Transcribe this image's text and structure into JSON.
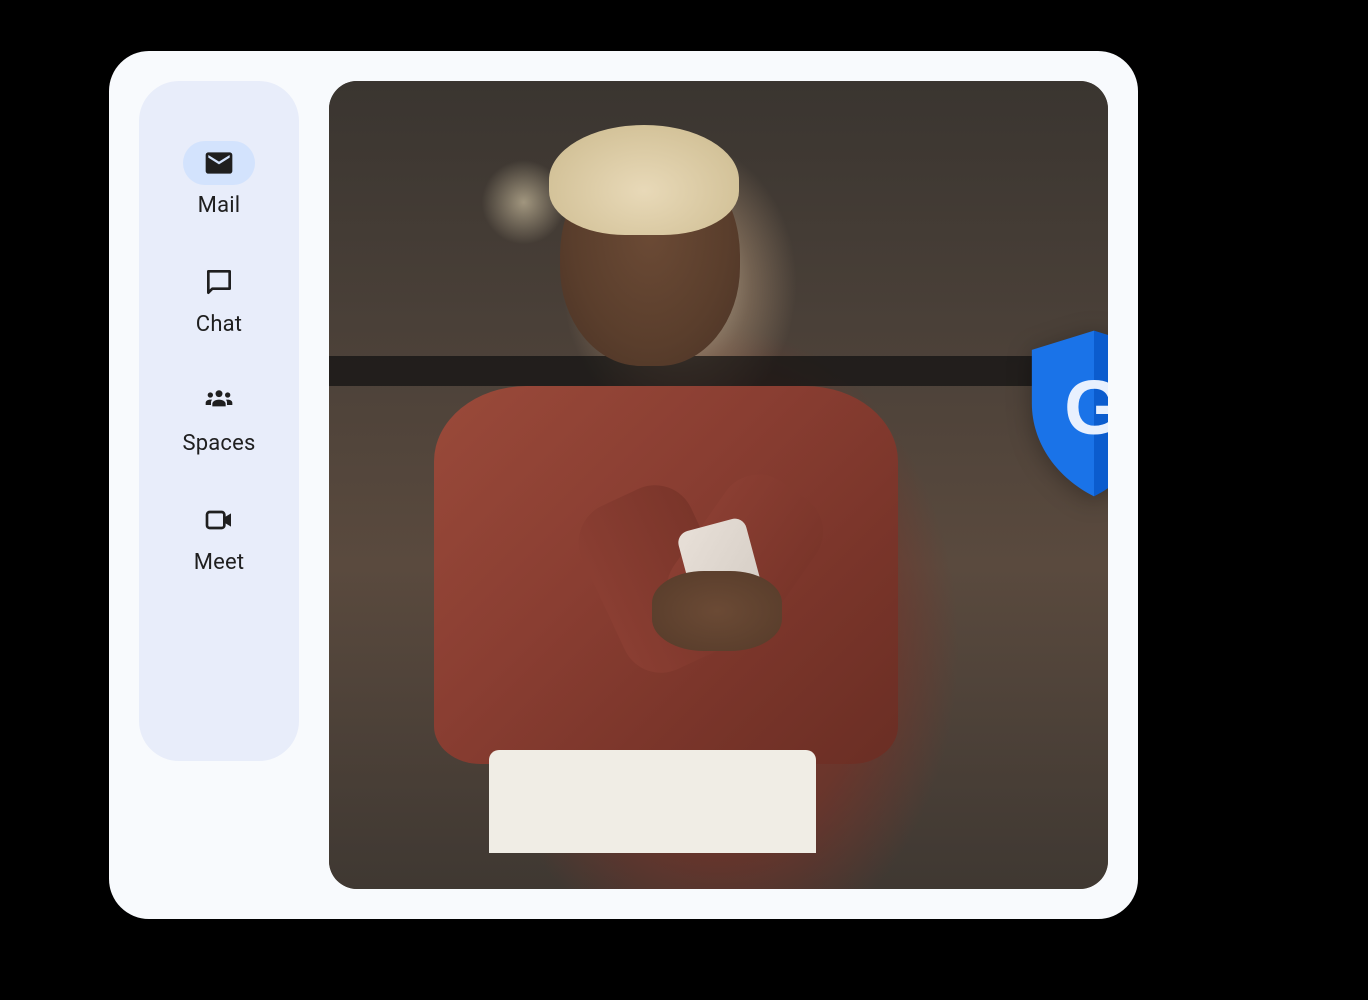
{
  "sidebar": {
    "items": [
      {
        "label": "Mail",
        "icon": "mail-icon",
        "active": true
      },
      {
        "label": "Chat",
        "icon": "chat-icon",
        "active": false
      },
      {
        "label": "Spaces",
        "icon": "spaces-icon",
        "active": false
      },
      {
        "label": "Meet",
        "icon": "meet-icon",
        "active": false
      }
    ]
  },
  "badge": {
    "letter": "G",
    "shield_color_left": "#1a73e8",
    "shield_color_right": "#0b5cce"
  },
  "colors": {
    "card_bg": "#f8fafd",
    "sidebar_bg": "#e8edfa",
    "active_pill": "#d3e3fd",
    "text": "#1f1f1f"
  }
}
